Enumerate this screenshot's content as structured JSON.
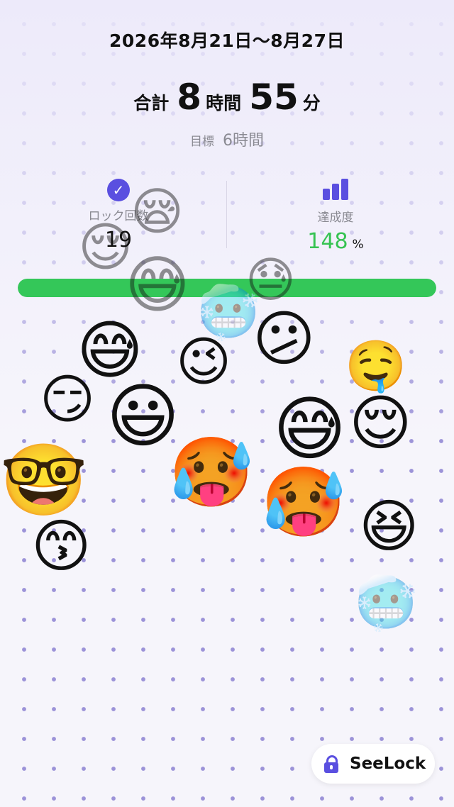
{
  "header": {
    "date_range": "2026年8月21日〜8月27日",
    "total_prefix": "合計",
    "hours": "8",
    "hours_unit": "時間",
    "minutes": "55",
    "minutes_unit": "分",
    "goal_label": "目標",
    "goal_value": "6時間"
  },
  "stats": {
    "lock_count_label": "ロック回数",
    "lock_count_value": "19",
    "achievement_label": "達成度",
    "achievement_value": "148",
    "achievement_unit": "%"
  },
  "progress": {
    "percent": 148
  },
  "emojis": [
    {
      "name": "emoji-sleepy-face",
      "glyph": "😪",
      "faded": true
    },
    {
      "name": "emoji-relieved-face",
      "glyph": "😌",
      "faded": true
    },
    {
      "name": "emoji-grinning-sweat-face",
      "glyph": "😅",
      "faded": true
    },
    {
      "name": "emoji-downcast-sweat-face",
      "glyph": "😓",
      "faded": true
    },
    {
      "name": "emoji-cold-face",
      "glyph": "🥶",
      "faded": true
    },
    {
      "name": "emoji-grinning-sweat-face-2",
      "glyph": "😅",
      "faded": false
    },
    {
      "name": "emoji-confused-face",
      "glyph": "😕",
      "faded": false
    },
    {
      "name": "emoji-winking-face",
      "glyph": "😉",
      "faded": false
    },
    {
      "name": "emoji-drooling-face",
      "glyph": "🤤",
      "faded": false
    },
    {
      "name": "emoji-smirking-face",
      "glyph": "😏",
      "faded": false
    },
    {
      "name": "emoji-grinning-big-eyes-face",
      "glyph": "😃",
      "faded": false
    },
    {
      "name": "emoji-grinning-sweat-face-3",
      "glyph": "😅",
      "faded": false
    },
    {
      "name": "emoji-relieved-face-2",
      "glyph": "😌",
      "faded": false
    },
    {
      "name": "emoji-hot-face",
      "glyph": "🥵",
      "faded": false
    },
    {
      "name": "emoji-hot-face-2",
      "glyph": "🥵",
      "faded": false
    },
    {
      "name": "emoji-nerd-face",
      "glyph": "🤓",
      "faded": false
    },
    {
      "name": "emoji-kissing-face",
      "glyph": "😙",
      "faded": false
    },
    {
      "name": "emoji-grinning-squinting-face",
      "glyph": "😆",
      "faded": false
    },
    {
      "name": "emoji-cold-face-2",
      "glyph": "🥶",
      "faded": true
    }
  ],
  "brand": {
    "name": "SeeLock"
  },
  "colors": {
    "accent": "#5a4fe0",
    "progress": "#34c759",
    "dot": "#9c93d8"
  }
}
